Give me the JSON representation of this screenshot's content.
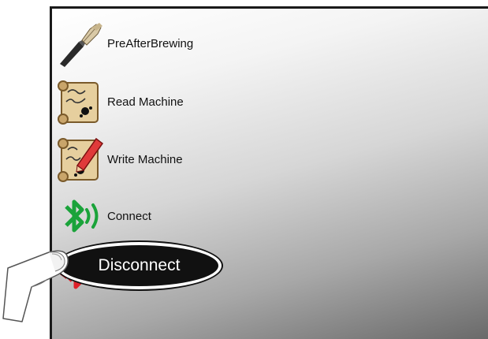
{
  "menu": {
    "items": [
      {
        "label": "PreAfterBrewing",
        "icon": "brush-icon"
      },
      {
        "label": "Read Machine",
        "icon": "scroll-icon"
      },
      {
        "label": "Write Machine",
        "icon": "scroll-pen-icon"
      },
      {
        "label": "Connect",
        "icon": "bluetooth-connect-icon"
      },
      {
        "label": "",
        "icon": "bluetooth-disconnect-icon"
      }
    ]
  },
  "callout": {
    "label": "Disconnect"
  },
  "colors": {
    "bluetooth_connect": "#1aa33a",
    "bluetooth_disconnect": "#e0202a",
    "callout_bg": "#111111",
    "callout_text": "#ffffff"
  },
  "icons": {
    "pointer": "finger-pointer-icon"
  }
}
